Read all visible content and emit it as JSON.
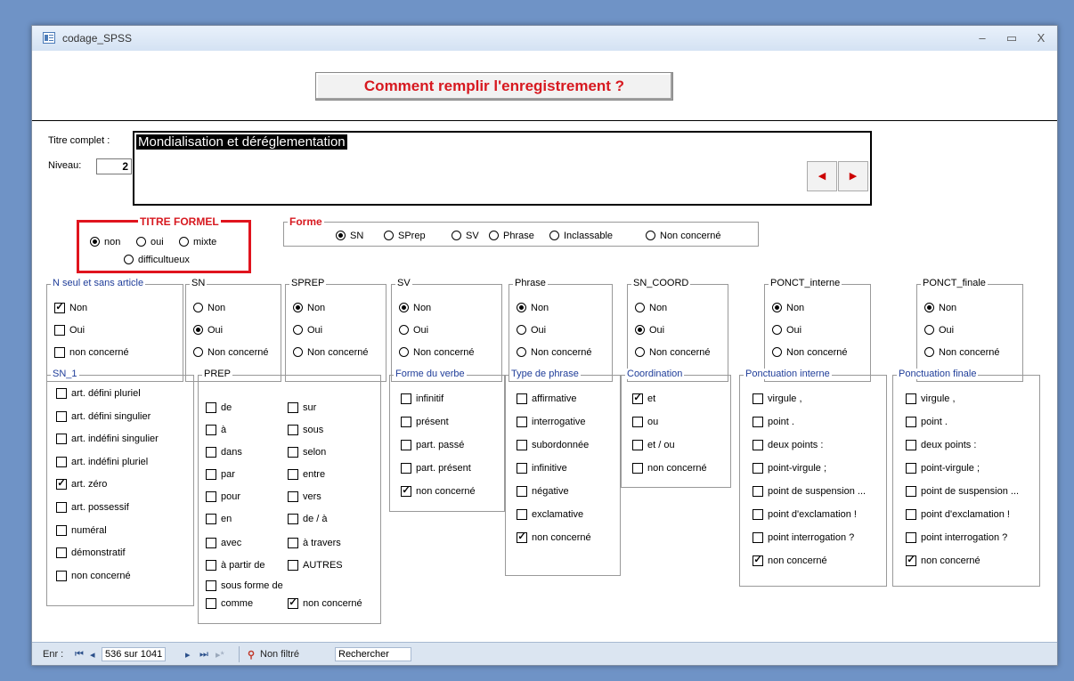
{
  "window": {
    "title": "codage_SPSS",
    "controls": {
      "minimize": "–",
      "maximize": "▭",
      "close": "X"
    }
  },
  "header": {
    "help_button": "Comment remplir l'enregistrement ?"
  },
  "record": {
    "titre_label": "Titre complet :",
    "titre_value": "Mondialisation et déréglementation",
    "niveau_label": "Niveau:",
    "niveau_value": "2",
    "nav_prev": "◀",
    "nav_next": "▶"
  },
  "groups": {
    "titre_formel": {
      "legend": "TITRE FORMEL",
      "options": [
        {
          "label": "non",
          "selected": true
        },
        {
          "label": "oui",
          "selected": false
        },
        {
          "label": "mixte",
          "selected": false
        },
        {
          "label": "difficultueux",
          "selected": false
        }
      ]
    },
    "forme": {
      "legend": "Forme",
      "options": [
        {
          "label": "SN",
          "selected": true
        },
        {
          "label": "SPrep",
          "selected": false
        },
        {
          "label": "SV",
          "selected": false
        },
        {
          "label": "Phrase",
          "selected": false
        },
        {
          "label": "Inclassable",
          "selected": false
        },
        {
          "label": "Non concerné",
          "selected": false
        }
      ]
    },
    "n_seul": {
      "legend": "N seul et sans article",
      "options": [
        {
          "label": "Non",
          "checked": true
        },
        {
          "label": "Oui",
          "checked": false
        },
        {
          "label": "non concerné",
          "checked": false
        }
      ]
    },
    "sn": {
      "legend": "SN",
      "options": [
        {
          "label": "Non",
          "selected": false
        },
        {
          "label": "Oui",
          "selected": true
        },
        {
          "label": "Non concerné",
          "selected": false
        }
      ]
    },
    "sprep": {
      "legend": "SPREP",
      "options": [
        {
          "label": "Non",
          "selected": true
        },
        {
          "label": "Oui",
          "selected": false
        },
        {
          "label": "Non concerné",
          "selected": false
        }
      ]
    },
    "sv": {
      "legend": "SV",
      "options": [
        {
          "label": "Non",
          "selected": true
        },
        {
          "label": "Oui",
          "selected": false
        },
        {
          "label": "Non concerné",
          "selected": false
        }
      ]
    },
    "phrase": {
      "legend": "Phrase",
      "options": [
        {
          "label": "Non",
          "selected": true
        },
        {
          "label": "Oui",
          "selected": false
        },
        {
          "label": "Non concerné",
          "selected": false
        }
      ]
    },
    "sn_coord": {
      "legend": "SN_COORD",
      "options": [
        {
          "label": "Non",
          "selected": false
        },
        {
          "label": "Oui",
          "selected": true
        },
        {
          "label": "Non concerné",
          "selected": false
        }
      ]
    },
    "ponct_interne": {
      "legend": "PONCT_interne",
      "options": [
        {
          "label": "Non",
          "selected": true
        },
        {
          "label": "Oui",
          "selected": false
        },
        {
          "label": "Non concerné",
          "selected": false
        }
      ]
    },
    "ponct_finale": {
      "legend": "PONCT_finale",
      "options": [
        {
          "label": "Non",
          "selected": true
        },
        {
          "label": "Oui",
          "selected": false
        },
        {
          "label": "Non concerné",
          "selected": false
        }
      ]
    },
    "sn_1": {
      "legend": "SN_1",
      "options": [
        {
          "label": "art. défini pluriel",
          "checked": false
        },
        {
          "label": "art. défini singulier",
          "checked": false
        },
        {
          "label": "art. indéfini singulier",
          "checked": false
        },
        {
          "label": "art. indéfini pluriel",
          "checked": false
        },
        {
          "label": "art. zéro",
          "checked": true
        },
        {
          "label": "art. possessif",
          "checked": false
        },
        {
          "label": "numéral",
          "checked": false
        },
        {
          "label": "démonstratif",
          "checked": false
        },
        {
          "label": "non concerné",
          "checked": false
        }
      ]
    },
    "prep": {
      "legend": "PREP",
      "col1": [
        {
          "label": "de",
          "checked": false
        },
        {
          "label": "à",
          "checked": false
        },
        {
          "label": "dans",
          "checked": false
        },
        {
          "label": "par",
          "checked": false
        },
        {
          "label": "pour",
          "checked": false
        },
        {
          "label": "en",
          "checked": false
        },
        {
          "label": "avec",
          "checked": false
        },
        {
          "label": "à partir de",
          "checked": false
        },
        {
          "label": "sous forme de",
          "checked": false
        },
        {
          "label": "comme",
          "checked": false
        }
      ],
      "col2": [
        {
          "label": "sur",
          "checked": false
        },
        {
          "label": "sous",
          "checked": false
        },
        {
          "label": "selon",
          "checked": false
        },
        {
          "label": "entre",
          "checked": false
        },
        {
          "label": "vers",
          "checked": false
        },
        {
          "label": "de / à",
          "checked": false
        },
        {
          "label": "à travers",
          "checked": false
        },
        {
          "label": "AUTRES",
          "checked": false
        },
        {
          "label": "non concerné",
          "checked": true
        }
      ]
    },
    "forme_verbe": {
      "legend": "Forme du verbe",
      "options": [
        {
          "label": "infinitif",
          "checked": false
        },
        {
          "label": "présent",
          "checked": false
        },
        {
          "label": "part. passé",
          "checked": false
        },
        {
          "label": "part. présent",
          "checked": false
        },
        {
          "label": "non concerné",
          "checked": true
        }
      ]
    },
    "type_phrase": {
      "legend": "Type de phrase",
      "options": [
        {
          "label": "affirmative",
          "checked": false
        },
        {
          "label": "interrogative",
          "checked": false
        },
        {
          "label": "subordonnée",
          "checked": false
        },
        {
          "label": "infinitive",
          "checked": false
        },
        {
          "label": "négative",
          "checked": false
        },
        {
          "label": "exclamative",
          "checked": false
        },
        {
          "label": "non concerné",
          "checked": true
        }
      ]
    },
    "coordination": {
      "legend": "Coordination",
      "options": [
        {
          "label": "et",
          "checked": true
        },
        {
          "label": "ou",
          "checked": false
        },
        {
          "label": "et / ou",
          "checked": false
        },
        {
          "label": "non concerné",
          "checked": false
        }
      ]
    },
    "ponctuation_interne": {
      "legend": "Ponctuation interne",
      "options": [
        {
          "label": "virgule ,",
          "checked": false
        },
        {
          "label": "point .",
          "checked": false
        },
        {
          "label": "deux points :",
          "checked": false
        },
        {
          "label": "point-virgule ;",
          "checked": false
        },
        {
          "label": "point de suspension ...",
          "checked": false
        },
        {
          "label": "point d'exclamation !",
          "checked": false
        },
        {
          "label": "point interrogation ?",
          "checked": false
        },
        {
          "label": "non concerné",
          "checked": true
        }
      ]
    },
    "ponctuation_finale": {
      "legend": "Ponctuation finale",
      "options": [
        {
          "label": "virgule ,",
          "checked": false
        },
        {
          "label": "point .",
          "checked": false
        },
        {
          "label": "deux points :",
          "checked": false
        },
        {
          "label": "point-virgule ;",
          "checked": false
        },
        {
          "label": "point de suspension ...",
          "checked": false
        },
        {
          "label": "point d'exclamation !",
          "checked": false
        },
        {
          "label": "point interrogation ?",
          "checked": false
        },
        {
          "label": "non concerné",
          "checked": true
        }
      ]
    }
  },
  "statusbar": {
    "enr_label": "Enr :",
    "first": "⏮",
    "prev": "◂",
    "record_position": "536 sur 1041",
    "next": "▸",
    "last": "⏭",
    "new": "▸*",
    "filter_status": "Non filtré",
    "search": "Rechercher"
  },
  "colors": {
    "accent_red": "#d71920",
    "legend_blue": "#1f3d99",
    "desktop": "#6f93c6"
  }
}
